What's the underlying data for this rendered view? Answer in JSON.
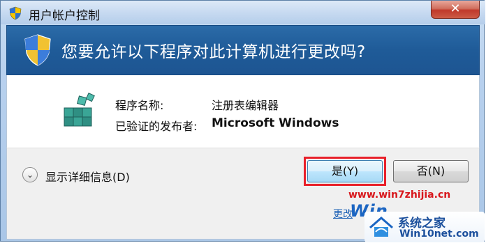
{
  "window": {
    "title": "用户帐户控制",
    "close_label": "✕"
  },
  "header": {
    "question": "您要允许以下程序对此计算机进行更改吗?"
  },
  "program": {
    "name_label": "程序名称:",
    "name_value": "注册表编辑器",
    "publisher_label": "已验证的发布者:",
    "publisher_value": "Microsoft Windows"
  },
  "footer": {
    "details_icon": "⌄",
    "details_label": "显示详细信息(D)",
    "yes_label": "是(Y)",
    "no_label": "否(N)",
    "change_link": "更改"
  },
  "watermarks": {
    "site1": "www.win7zhijia.cn",
    "logo": "Win",
    "site2_title": "系统之家",
    "site2_url": "Win10net.com"
  },
  "colors": {
    "header_bg": "#1f5b98",
    "highlight": "#e8202a",
    "close": "#c0392b"
  }
}
